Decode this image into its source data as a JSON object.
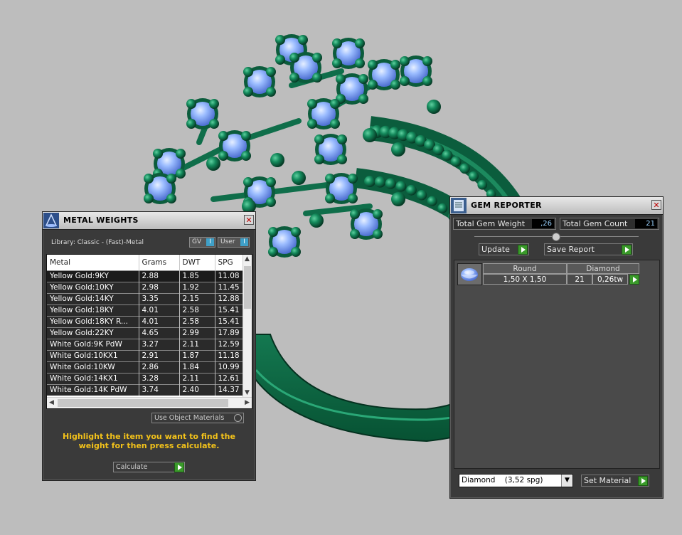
{
  "metal_panel": {
    "title": "METAL WEIGHTS",
    "library": "Library: Classic - (Fast)-Metal",
    "toggle_gv": "GV",
    "toggle_user": "User",
    "toggle_indicator": "I",
    "columns": [
      "Metal",
      "Grams",
      "DWT",
      "SPG"
    ],
    "rows": [
      [
        "Yellow Gold:9KY",
        "2.88",
        "1.85",
        "11.08"
      ],
      [
        "Yellow Gold:10KY",
        "2.98",
        "1.92",
        "11.45"
      ],
      [
        "Yellow Gold:14KY",
        "3.35",
        "2.15",
        "12.88"
      ],
      [
        "Yellow Gold:18KY",
        "4.01",
        "2.58",
        "15.41"
      ],
      [
        "Yellow Gold:18KY R...",
        "4.01",
        "2.58",
        "15.41"
      ],
      [
        "Yellow Gold:22KY",
        "4.65",
        "2.99",
        "17.89"
      ],
      [
        "White Gold:9K PdW",
        "3.27",
        "2.11",
        "12.59"
      ],
      [
        "White Gold:10KX1",
        "2.91",
        "1.87",
        "11.18"
      ],
      [
        "White Gold:10KW",
        "2.86",
        "1.84",
        "10.99"
      ],
      [
        "White Gold:14KX1",
        "3.28",
        "2.11",
        "12.61"
      ],
      [
        "White Gold:14K PdW",
        "3.74",
        "2.40",
        "14.37"
      ]
    ],
    "use_object_materials": "Use Object Materials",
    "hint": "Highlight the item you want to find the weight for then press calculate.",
    "calculate": "Calculate"
  },
  "gem_panel": {
    "title": "GEM REPORTER",
    "total_weight_label": "Total Gem Weight",
    "total_weight_value": ",26",
    "total_count_label": "Total Gem Count",
    "total_count_value": "21",
    "update": "Update",
    "save_report": "Save Report",
    "gem": {
      "shape": "Round",
      "material": "Diamond",
      "size": "1,50 X 1,50",
      "count": "21",
      "weight": "0,26tw"
    },
    "material_select": "Diamond    (3,52 spg)",
    "set_material": "Set Material"
  },
  "colors": {
    "model_green": "#0f6e4a",
    "gem_blue": "#8fb4ff",
    "panel_bg": "#3a3a3a",
    "hint_yellow": "#f3c21a",
    "viewport_bg": "#bdbdbd"
  }
}
